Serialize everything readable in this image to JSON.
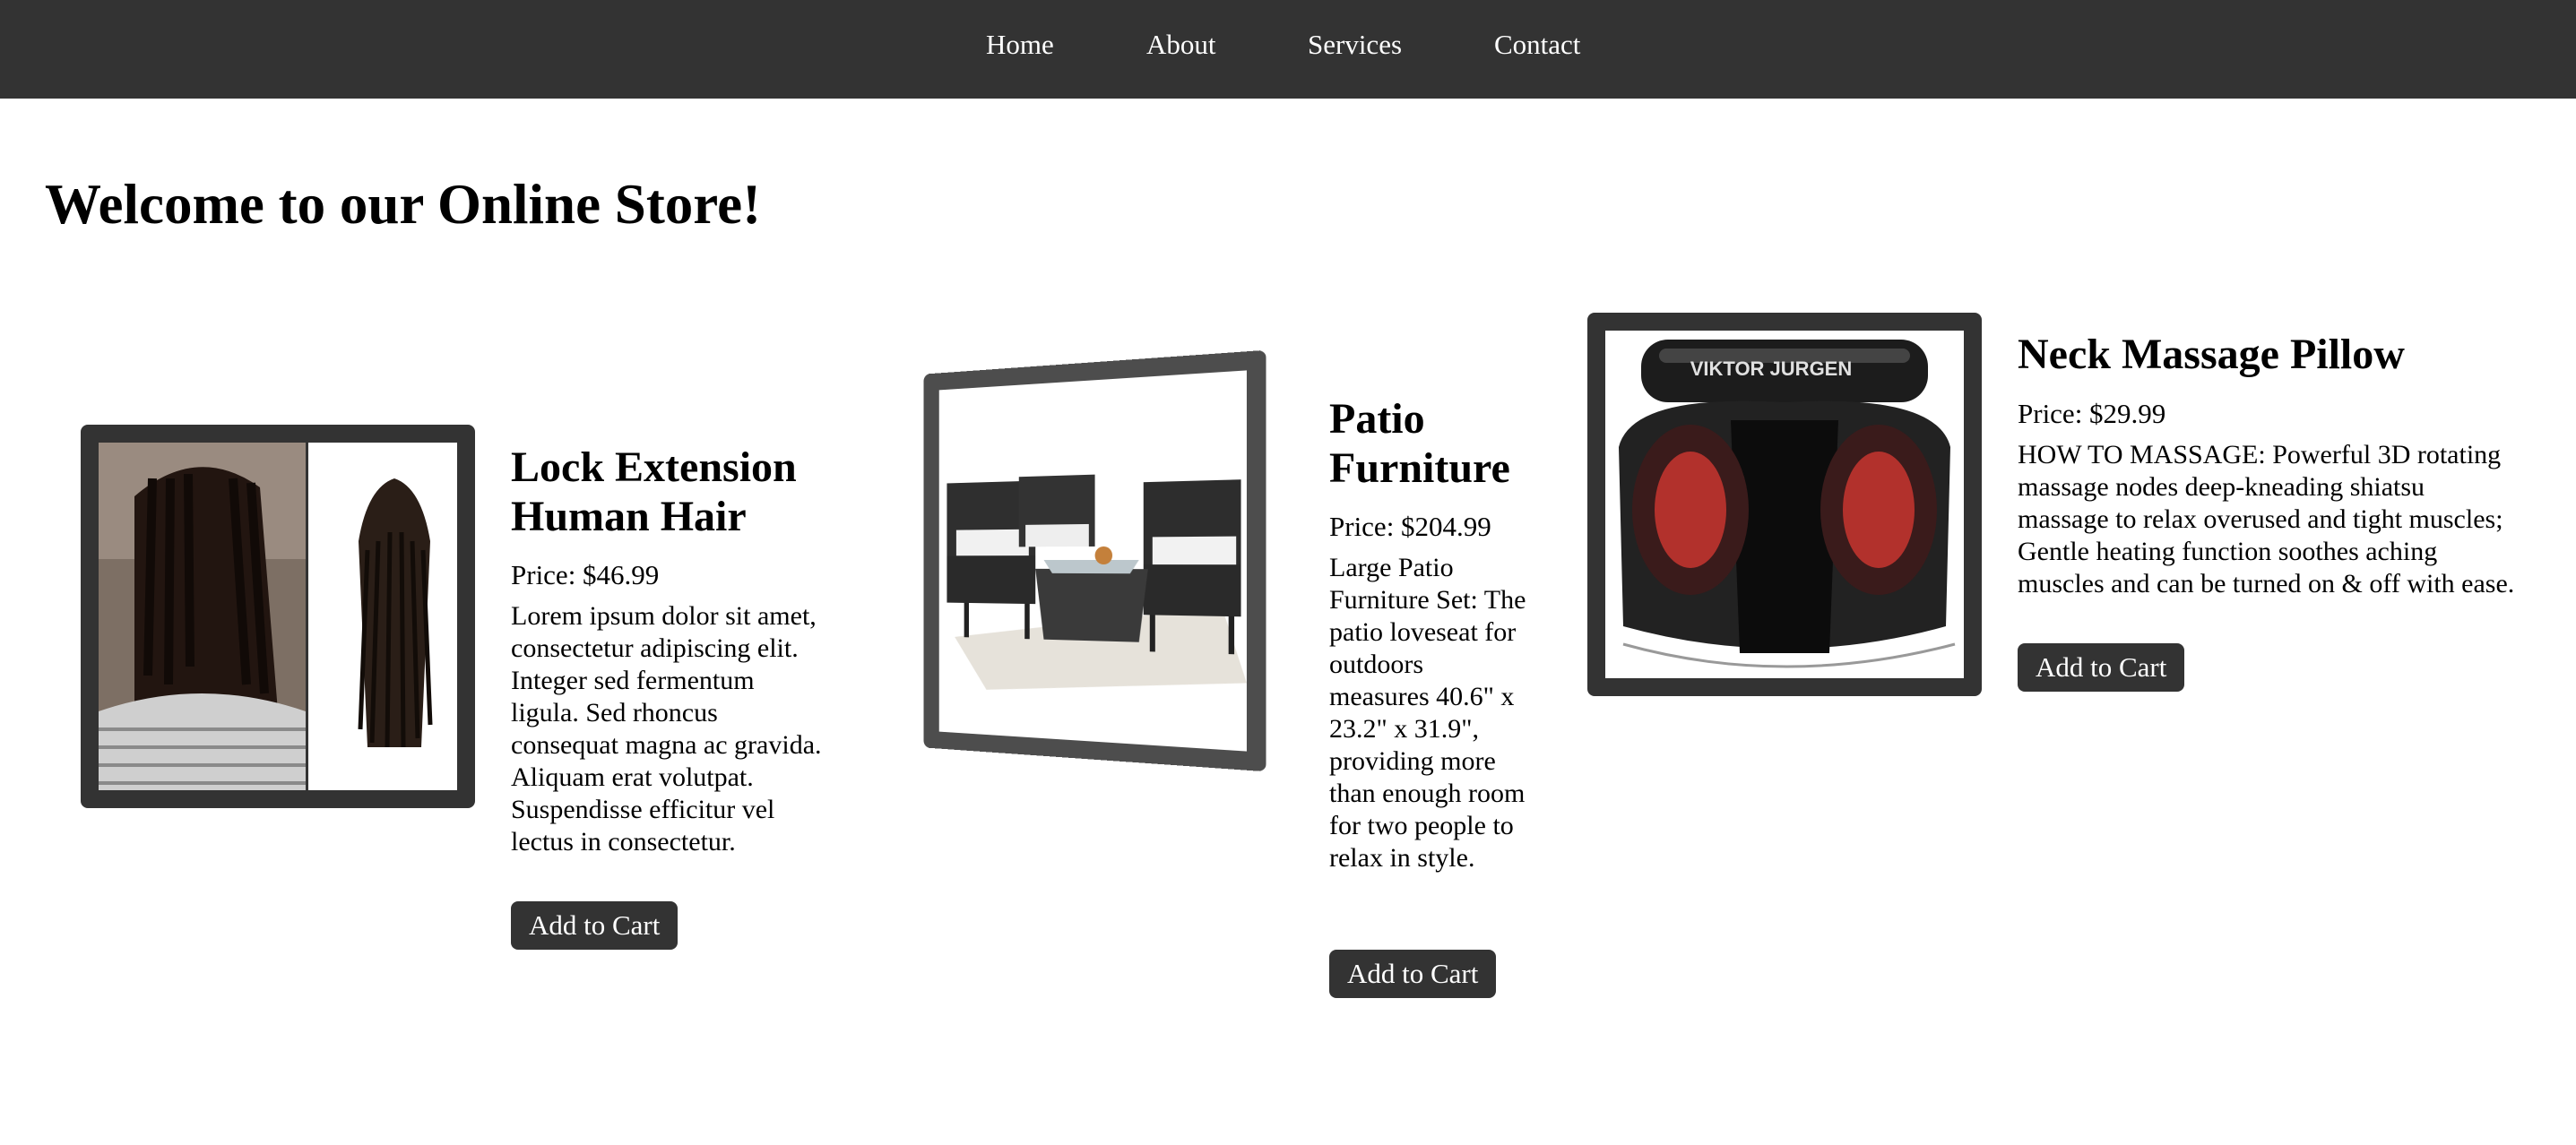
{
  "nav": {
    "items": [
      {
        "label": "Home"
      },
      {
        "label": "About"
      },
      {
        "label": "Services"
      },
      {
        "label": "Contact"
      }
    ]
  },
  "page": {
    "title": "Welcome to our Online Store!"
  },
  "products": [
    {
      "title": "Lock Extension Human Hair",
      "price": "Price: $46.99",
      "description": "Lorem ipsum dolor sit amet, consectetur adipiscing elit. Integer sed fermentum ligula. Sed rhoncus consequat magna ac gravida. Aliquam erat volutpat. Suspendisse efficitur vel lectus in consectetur.",
      "button": "Add to Cart",
      "image_alt": "Woman with dreadlocks and a bundle of loc extensions"
    },
    {
      "title": "Patio Furniture",
      "price": "Price: $204.99",
      "description": "Large Patio Furniture Set: The patio loveseat for outdoors measures 40.6\" x 23.2\" x 31.9\", providing more than enough room for two people to relax in style.",
      "button": "Add to Cart",
      "image_alt": "Black wicker patio chairs, loveseat and glass table"
    },
    {
      "title": "Neck Massage Pillow",
      "price": "Price: $29.99",
      "description": "HOW TO MASSAGE: Powerful 3D rotating massage nodes deep-kneading shiatsu massage to relax overused and tight muscles; Gentle heating function soothes aching muscles and can be turned on & off with ease.",
      "button": "Add to Cart",
      "image_alt": "Black neck massage pillow with red glowing nodes",
      "image_brand": "VIKTOR JURGEN"
    }
  ]
}
